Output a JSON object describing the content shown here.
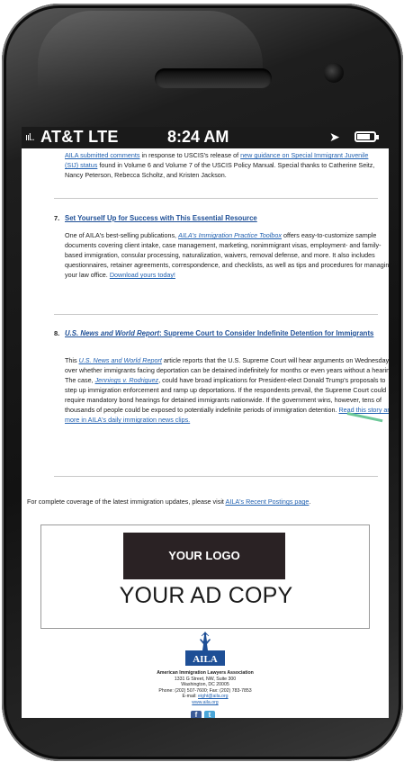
{
  "status_bar": {
    "signal": "ııl..",
    "carrier": "AT&T  LTE",
    "time": "8:24 AM",
    "location_icon": "location-arrow-icon",
    "battery_level": 0.72
  },
  "intro": {
    "link1": "AILA submitted comments",
    "text1": " in response to USCIS's release of ",
    "link2": "new guidance on Special Immigrant Juvenile (SIJ) status",
    "text2": " found in Volume 6 and Volume 7 of the USCIS Policy Manual. Special thanks to Catherine Seitz, Nancy Peterson, Rebecca Scholtz, and Kristen Jackson."
  },
  "item7": {
    "number": "7.",
    "title": "Set Yourself Up for Success with This Essential Resource",
    "text1": "One of AILA's best-selling publications, ",
    "pub_link": "AILA's Immigration Practice Toolbox",
    "text2": " offers easy-to-customize sample documents covering client intake, case management, marketing, nonimmigrant visas, employment- and family-based immigration, consular processing, naturalization, waivers, removal defense, and more. It also includes questionnaires, retainer agreements, correspondence, and checklists, as well as tips and procedures for managing your law office. ",
    "download_link": "Download yours today!"
  },
  "item8": {
    "number": "8.",
    "title_italic": "U.S. News and World Report",
    "title_rest": ": Supreme Court to Consider Indefinite Detention for Immigrants",
    "text1": "This ",
    "source_link": "U.S. News and World Report",
    "text2": " article reports that the U.S. Supreme Court will hear arguments on Wednesday over whether immigrants facing deportation can be detained indefinitely for months or even years without a hearing. The case, ",
    "case_link": "Jennings v. Rodriguez",
    "text3": ", could have broad implications for President-elect Donald Trump's proposals to step up immigration enforcement and ramp up deportations. If the respondents prevail, the Supreme Court could require mandatory bond hearings for detained immigrants nationwide. If the government wins, however, tens of thousands of people could be exposed to potentially indefinite periods of immigration detention. ",
    "read_link": "Read this story and more in AILA's daily immigration news clips."
  },
  "coverage": {
    "text": "For complete coverage of the latest immigration updates, please visit ",
    "link": "AILA's Recent Postings page",
    "end": "."
  },
  "ad": {
    "logo_label": "YOUR LOGO",
    "copy": "YOUR AD COPY"
  },
  "org": {
    "logo_text": "AILA",
    "name": "American Immigration Lawyers Association",
    "street": "1331 G Street, NW, Suite 300",
    "city": "Washington, DC 20005",
    "phone": "Phone: (202) 507-7600;  Fax: (202) 783-7853",
    "email_label": "E-mail: ",
    "email": "eight@aila.org",
    "website": "www.aila.org",
    "facebook_icon": "facebook-icon",
    "twitter_icon": "twitter-icon"
  },
  "colors": {
    "link": "#2060b0",
    "title": "#1e4f96",
    "ad_logo_bg": "#2a2224",
    "accent_line": "#6ec99a"
  }
}
